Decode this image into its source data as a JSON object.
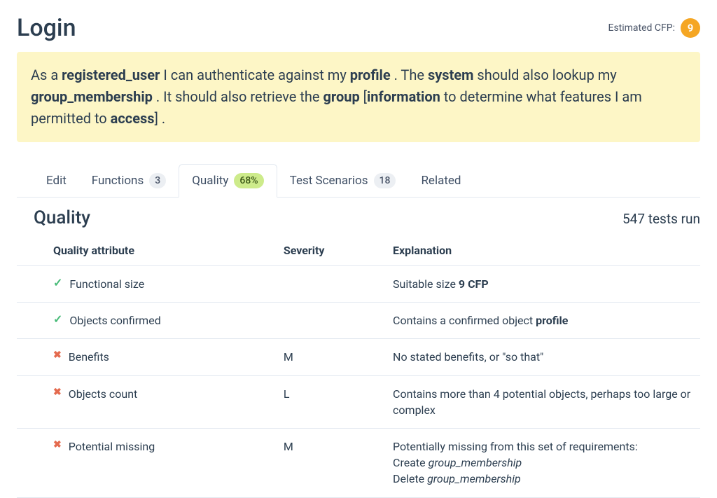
{
  "header": {
    "title": "Login",
    "cfp_label": "Estimated CFP:",
    "cfp_value": "9"
  },
  "story": {
    "parts": [
      {
        "t": "As a ",
        "b": false
      },
      {
        "t": "registered_user",
        "b": true
      },
      {
        "t": " I can authenticate against my ",
        "b": false
      },
      {
        "t": "profile",
        "b": true
      },
      {
        "t": " . The ",
        "b": false
      },
      {
        "t": "system",
        "b": true
      },
      {
        "t": " should also lookup my ",
        "b": false
      },
      {
        "t": "group_membership",
        "b": true
      },
      {
        "t": " . It should also retrieve the ",
        "b": false
      },
      {
        "t": "group",
        "b": true
      },
      {
        "t": " [",
        "b": false
      },
      {
        "t": "information",
        "b": true
      },
      {
        "t": " to determine what features I am permitted to ",
        "b": false
      },
      {
        "t": "access",
        "b": true
      },
      {
        "t": "] .",
        "b": false
      }
    ]
  },
  "tabs": {
    "edit": "Edit",
    "functions": "Functions",
    "functions_count": "3",
    "quality": "Quality",
    "quality_pct": "68%",
    "scenarios": "Test Scenarios",
    "scenarios_count": "18",
    "related": "Related"
  },
  "section": {
    "title": "Quality",
    "tests_run_prefix": "547",
    "tests_run_suffix": " tests run"
  },
  "table": {
    "col_attr": "Quality attribute",
    "col_sev": "Severity",
    "col_exp": "Explanation",
    "rows": [
      {
        "status": "ok",
        "attr": "Functional size",
        "severity": "",
        "exp_pre": "Suitable size ",
        "exp_bold": "9 CFP",
        "exp_post": ""
      },
      {
        "status": "ok",
        "attr": "Objects confirmed",
        "severity": "",
        "exp_pre": "Contains a confirmed object ",
        "exp_bold": "profile",
        "exp_post": ""
      },
      {
        "status": "fail",
        "attr": "Benefits",
        "severity": "M",
        "exp_pre": "No stated benefits, or \"so that\"",
        "exp_bold": "",
        "exp_post": ""
      },
      {
        "status": "fail",
        "attr": "Objects count",
        "severity": "L",
        "exp_pre": "Contains more than 4 potential objects, perhaps too large or complex",
        "exp_bold": "",
        "exp_post": ""
      },
      {
        "status": "fail",
        "attr": "Potential missing",
        "severity": "M",
        "exp_pre": "Potentially missing from this set of requirements:",
        "exp_missing": [
          {
            "action": "Create ",
            "obj": "group_membership"
          },
          {
            "action": "Delete ",
            "obj": "group_membership"
          }
        ]
      }
    ]
  }
}
